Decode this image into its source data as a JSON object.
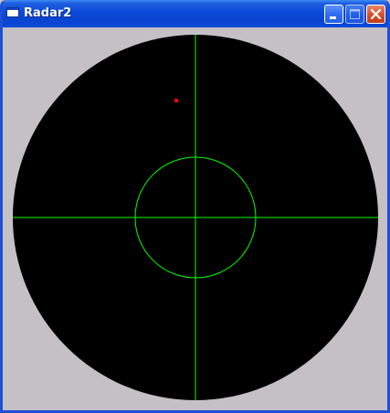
{
  "window": {
    "title": "Radar2",
    "icons": {
      "app": "window-icon",
      "minimize": "minimize-icon",
      "maximize": "maximize-icon",
      "close": "close-icon"
    }
  },
  "colors": {
    "titlebar": "#0a44cf",
    "frame": "#1f4fd6",
    "client_background": "#c4c0c4",
    "radar_background": "#000000",
    "grid": "#00ff00",
    "blip": "#ff0000",
    "close_button": "#d6522d"
  },
  "radar": {
    "range_ring_fraction": 0.33,
    "blips": [
      {
        "x": -0.105,
        "y": 0.64
      }
    ]
  }
}
